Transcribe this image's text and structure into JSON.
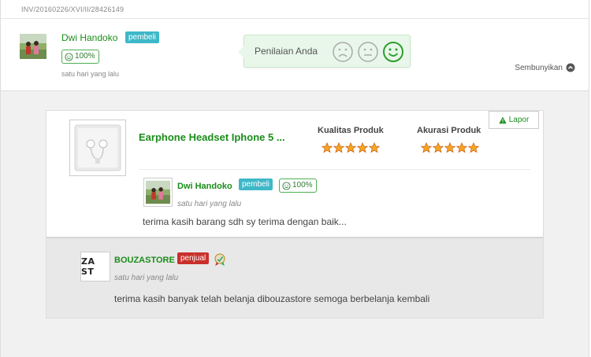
{
  "invoice": {
    "number": "INV/20160226/XVI/II/28426149"
  },
  "header": {
    "buyer_name": "Dwi Handoko",
    "buyer_badge": "pembeli",
    "reputation": "100%",
    "time": "satu hari yang lalu",
    "rating_prompt": "Penilaian Anda",
    "selected_rating": "happy",
    "hide_label": "Sembunyikan"
  },
  "review": {
    "product_name": "Earphone Headset Iphone 5 ...",
    "report_label": "Lapor",
    "quality_label": "Kualitas Produk",
    "quality_stars": 5,
    "accuracy_label": "Akurasi Produk",
    "accuracy_stars": 5,
    "reviewer_name": "Dwi Handoko",
    "reviewer_badge": "pembeli",
    "reviewer_reputation": "100%",
    "time": "satu hari yang lalu",
    "text": "terima kasih barang sdh sy terima dengan baik..."
  },
  "reply": {
    "store_name": "BOUZASTORE",
    "store_logo_text": "ZA ST",
    "seller_badge": "penjual",
    "time": "satu hari yang lalu",
    "text": "terima kasih banyak telah belanja dibouzastore semoga berbelanja kembali"
  },
  "colors": {
    "accent_green": "#1a8d1a",
    "buyer_badge": "#3eb8c9",
    "seller_badge": "#c9302c",
    "star": "#f5a623",
    "tooltip_bg": "#e8f7e9"
  }
}
